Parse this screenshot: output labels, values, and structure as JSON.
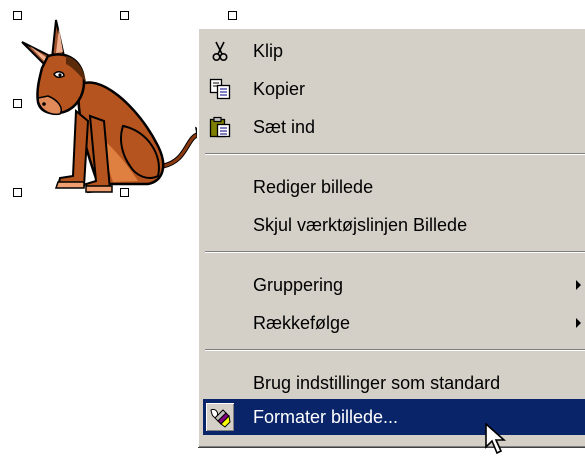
{
  "picture": {
    "name": "donkey clip art",
    "selection": "8 sizing handles"
  },
  "context_menu": {
    "cut_label": "Klip",
    "copy_label": "Kopier",
    "paste_label": "Sæt ind",
    "edit_picture_label": "Rediger billede",
    "hide_toolbar_label": "Skjul værktøjslinjen Billede",
    "grouping_label": "Gruppering",
    "order_label": "Rækkefølge",
    "set_default_label": "Brug indstillinger som standard",
    "format_picture_label": "Formater billede...",
    "highlighted_item": "Formater billede...",
    "icons": {
      "cut": "scissors-icon",
      "copy": "copy-icon",
      "paste": "clipboard-icon",
      "format": "paintbrush-icon"
    },
    "colors": {
      "menu_face": "#d4d0c8",
      "highlight": "#0a246a",
      "highlight_text": "#ffffff"
    }
  },
  "cursor": {
    "icon": "arrow-pointer"
  }
}
